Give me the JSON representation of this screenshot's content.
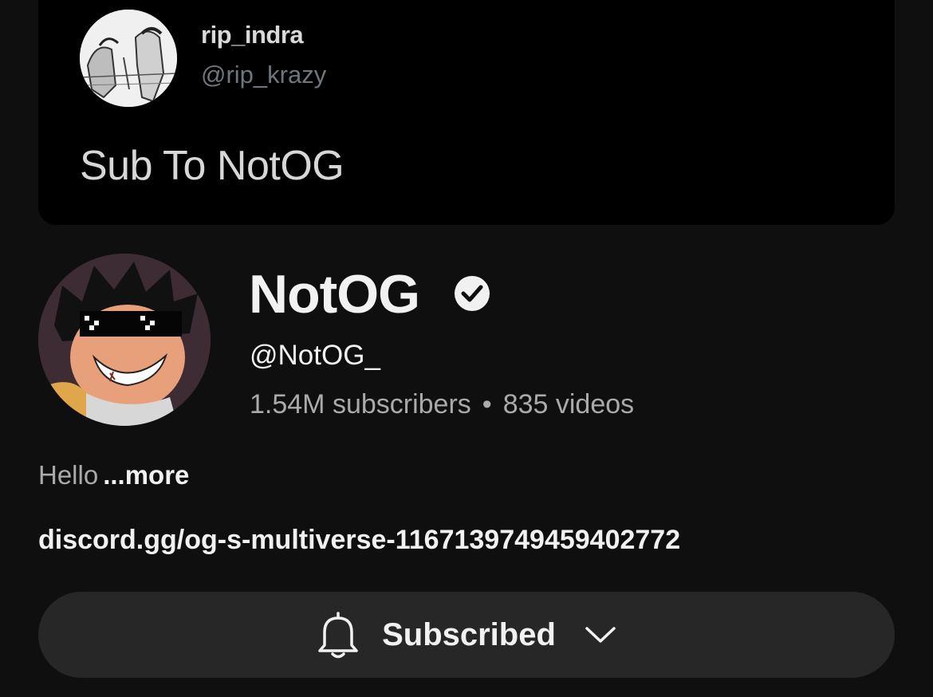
{
  "tweet": {
    "display_name": "rip_indra",
    "handle": "@rip_krazy",
    "text": "Sub To NotOG"
  },
  "channel": {
    "name": "NotOG",
    "verified": true,
    "handle": "@NotOG_",
    "subscribers": "1.54M subscribers",
    "separator": "•",
    "videos": "835 videos",
    "description": "Hello",
    "more_label": "...more",
    "link": "discord.gg/og-s-multiverse-1167139749459402772"
  },
  "subscribe_button": {
    "label": "Subscribed",
    "icon": "bell-icon",
    "dropdown_icon": "chevron-down-icon"
  },
  "colors": {
    "background": "#0f0f0f",
    "card": "#000000",
    "button": "#272727",
    "secondary_text": "#aaaaaa"
  }
}
